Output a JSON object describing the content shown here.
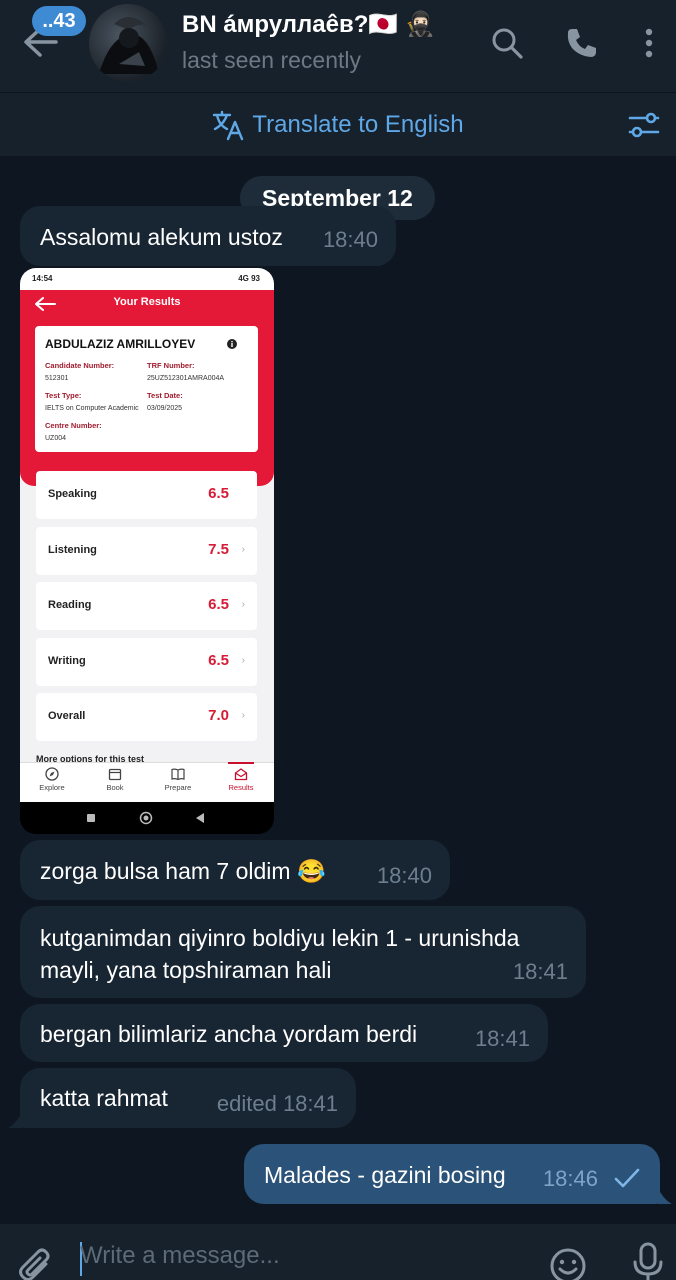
{
  "header": {
    "unread_count": "..43",
    "title": "BN áмруллаêв?🇯🇵 🥷🏻",
    "status": "last seen recently"
  },
  "translate": {
    "label": "Translate to English"
  },
  "date_chip": "September 12",
  "messages": [
    {
      "text": "Assalomu alekum ustoz",
      "time": "18:40",
      "direction": "in"
    },
    {
      "text": "zorga bulsa ham 7 oldim 😂",
      "time": "18:40",
      "direction": "in"
    },
    {
      "text_line1": "kutganimdan qiyinro boldiyu lekin 1 - urunishda",
      "text_line2": "mayli, yana topshiraman hali",
      "time": "18:41",
      "direction": "in"
    },
    {
      "text": "bergan bilimlariz ancha yordam berdi",
      "time": "18:41",
      "direction": "in"
    },
    {
      "text": "katta rahmat",
      "time": "edited 18:41",
      "direction": "in"
    },
    {
      "text": "Malades - gazini bosing",
      "time": "18:46",
      "direction": "out"
    }
  ],
  "shot": {
    "status_time": "14:54",
    "status_right": "4G 93",
    "title": "Your Results",
    "candidate_name": "ABDULAZIZ AMRILLOYEV",
    "fields": {
      "candidate_number_label": "Candidate Number:",
      "candidate_number": "512301",
      "trf_label": "TRF Number:",
      "trf": "25UZ512301AMRA004A",
      "test_type_label": "Test Type:",
      "test_type": "IELTS on Computer Academic",
      "test_date_label": "Test Date:",
      "test_date": "03/09/2025",
      "centre_label": "Centre Number:",
      "centre": "UZ004"
    },
    "scores": [
      {
        "name": "Speaking",
        "value": "6.5"
      },
      {
        "name": "Listening",
        "value": "7.5"
      },
      {
        "name": "Reading",
        "value": "6.5"
      },
      {
        "name": "Writing",
        "value": "6.5"
      },
      {
        "name": "Overall",
        "value": "7.0"
      }
    ],
    "more_options": "More options for this test",
    "nav": {
      "explore": "Explore",
      "book": "Book",
      "prepare": "Prepare",
      "results": "Results"
    }
  },
  "input": {
    "placeholder": "Write a message..."
  },
  "colors": {
    "bg": "#0e1621",
    "header": "#17212b",
    "bubble_in": "#182533",
    "bubble_out": "#2b5278",
    "accent": "#5fa8e8",
    "ielts_red": "#e31937"
  },
  "icons": [
    "back-arrow-icon",
    "search-icon",
    "phone-icon",
    "more-vertical-icon",
    "translate-icon",
    "filter-icon",
    "check-icon",
    "attach-icon",
    "emoji-icon",
    "microphone-icon"
  ]
}
